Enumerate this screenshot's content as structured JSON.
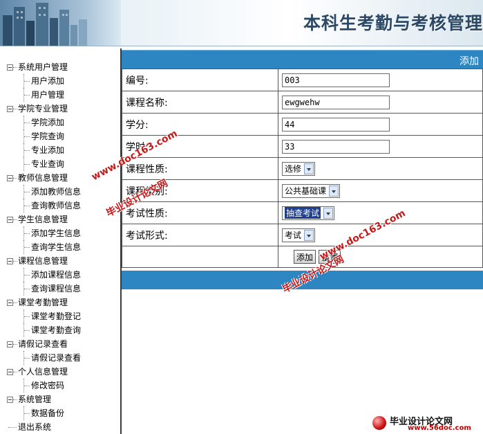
{
  "header": {
    "title": "本科生考勤与考核管理"
  },
  "sidebar": {
    "groups": [
      {
        "label": "系统用户管理",
        "items": [
          "用户添加",
          "用户管理"
        ]
      },
      {
        "label": "学院专业管理",
        "items": [
          "学院添加",
          "学院查询",
          "专业添加",
          "专业查询"
        ]
      },
      {
        "label": "教师信息管理",
        "items": [
          "添加教师信息",
          "查询教师信息"
        ]
      },
      {
        "label": "学生信息管理",
        "items": [
          "添加学生信息",
          "查询学生信息"
        ]
      },
      {
        "label": "课程信息管理",
        "items": [
          "添加课程信息",
          "查询课程信息"
        ]
      },
      {
        "label": "课堂考勤管理",
        "items": [
          "课堂考勤登记",
          "课堂考勤查询"
        ]
      },
      {
        "label": "请假记录查看",
        "items": [
          "请假记录查看"
        ]
      },
      {
        "label": "个人信息管理",
        "items": [
          "修改密码"
        ]
      },
      {
        "label": "系统管理",
        "items": [
          "数据备份"
        ]
      }
    ],
    "exit_label": "退出系统"
  },
  "form": {
    "banner": "添加",
    "fields": [
      {
        "label": "编号:",
        "type": "text",
        "value": "003"
      },
      {
        "label": "课程名称:",
        "type": "text",
        "value": "ewgwehw"
      },
      {
        "label": "学分:",
        "type": "text",
        "value": "44"
      },
      {
        "label": "学时:",
        "type": "text",
        "value": "33"
      },
      {
        "label": "课程性质:",
        "type": "select",
        "value": "选修"
      },
      {
        "label": "课程类别:",
        "type": "select",
        "value": "公共基础课"
      },
      {
        "label": "考试性质:",
        "type": "select",
        "value": "抽查考试",
        "highlighted": true
      },
      {
        "label": "考试形式:",
        "type": "select",
        "value": "考试"
      }
    ],
    "buttons": {
      "add": "添加",
      "reset": "重置"
    }
  },
  "watermark": {
    "url": "www.doc163.com",
    "text": "毕业设计论文网"
  },
  "footer": {
    "name": "毕业设计论文网",
    "url": "www.56doc.com"
  }
}
